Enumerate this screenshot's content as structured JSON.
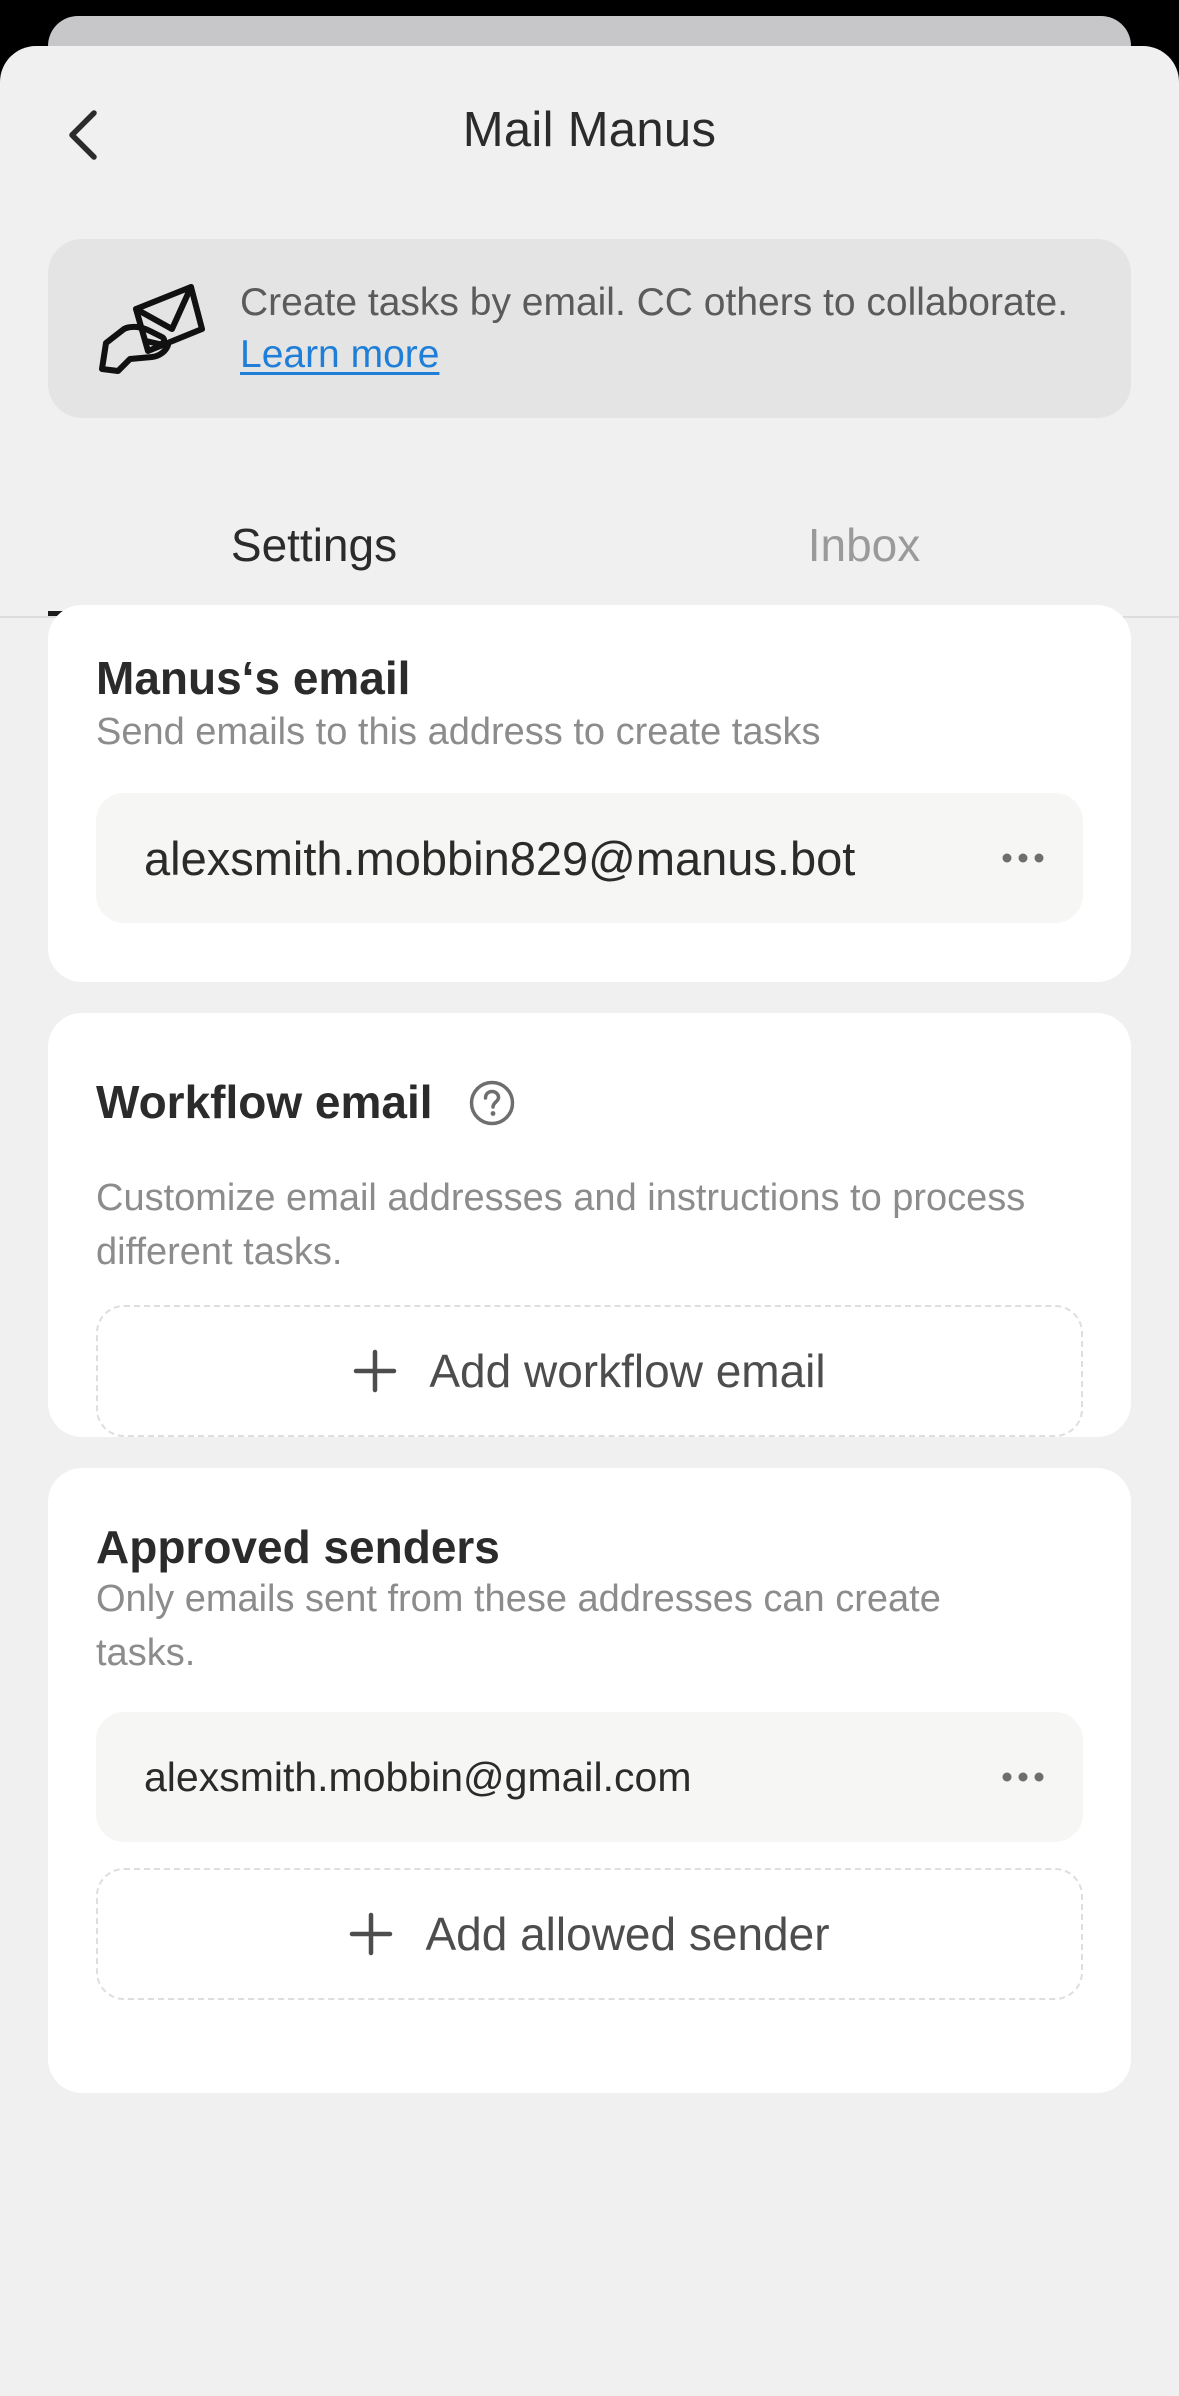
{
  "header": {
    "title": "Mail Manus"
  },
  "banner": {
    "text": "Create tasks by email. CC others to collaborate. ",
    "link_label": "Learn more"
  },
  "tabs": [
    {
      "label": "Settings",
      "active": true
    },
    {
      "label": "Inbox",
      "active": false
    }
  ],
  "manus_email": {
    "title": "Manus‘s email",
    "subtitle": "Send emails to this address to create tasks",
    "address": "alexsmith.mobbin829@manus.bot"
  },
  "workflow_email": {
    "title": "Workflow email",
    "subtitle": "Customize email addresses and instructions to process different tasks.",
    "add_label": "Add workflow email"
  },
  "approved_senders": {
    "title": "Approved senders",
    "subtitle": "Only emails sent from these addresses can create tasks.",
    "senders": [
      "alexsmith.mobbin@gmail.com"
    ],
    "add_label": "Add allowed sender"
  },
  "icons": {
    "back": "chevron-left-icon",
    "banner": "hand-envelope-icon",
    "help": "question-circle-icon",
    "more": "ellipsis-icon",
    "add": "plus-icon"
  },
  "colors": {
    "link": "#1f7fd8",
    "sheet_background": "#f0f0f0",
    "card_background": "#ffffff",
    "banner_background": "#e4e4e4"
  }
}
